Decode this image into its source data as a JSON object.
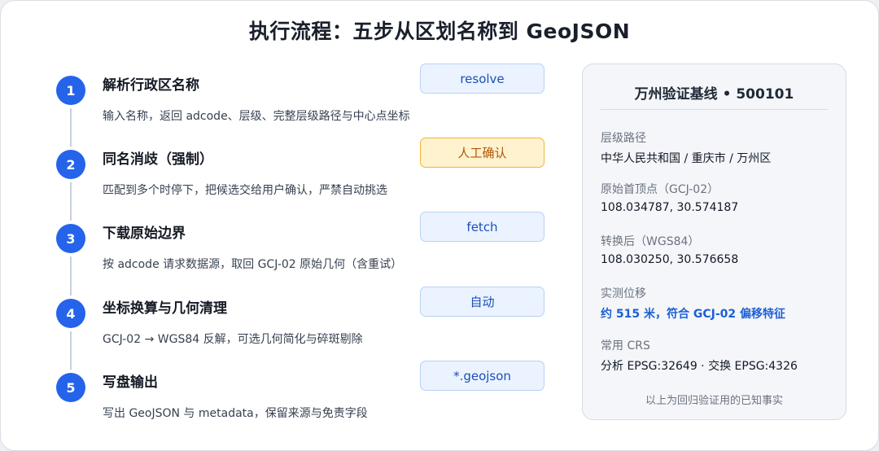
{
  "title": "执行流程：五步从区划名称到 GeoJSON",
  "steps": [
    {
      "num": "1",
      "title": "解析行政区名称",
      "tag": "resolve",
      "desc": "输入名称，返回 adcode、层级、完整层级路径与中心点坐标"
    },
    {
      "num": "2",
      "title": "同名消歧（强制）",
      "tag": "人工确认",
      "desc": "匹配到多个时停下，把候选交给用户确认，严禁自动挑选"
    },
    {
      "num": "3",
      "title": "下载原始边界",
      "tag": "fetch",
      "desc": "按 adcode 请求数据源，取回 GCJ-02 原始几何（含重试）"
    },
    {
      "num": "4",
      "title": "坐标换算与几何清理",
      "tag": "自动",
      "desc": "GCJ-02 → WGS84 反解，可选几何简化与碎斑剔除"
    },
    {
      "num": "5",
      "title": "写盘输出",
      "tag": "*.geojson",
      "desc": "写出 GeoJSON 与 metadata，保留来源与免责字段"
    }
  ],
  "panel": {
    "title": "万州验证基线 • 500101",
    "path_label": "层级路径",
    "path_value": "中华人民共和国 / 重庆市 / 万州区",
    "raw_label": "原始首顶点（GCJ-02）",
    "raw_value": "108.034787, 30.574187",
    "conv_label": "转换后（WGS84）",
    "conv_value": "108.030250, 30.576658",
    "offset_label": "实测位移",
    "offset_value": "约 515 米，符合 GCJ-02 偏移特征",
    "crs_label": "常用 CRS",
    "crs_value": "分析 EPSG:32649 · 交换 EPSG:4326",
    "footnote": "以上为回归验证用的已知事实"
  },
  "colors": {
    "accent": "#2563eb",
    "tag_bg": "#eaf3ff",
    "warn_bg": "#fff3cf",
    "warn_border": "#f0b43a",
    "highlight": "#1d5fd6"
  }
}
